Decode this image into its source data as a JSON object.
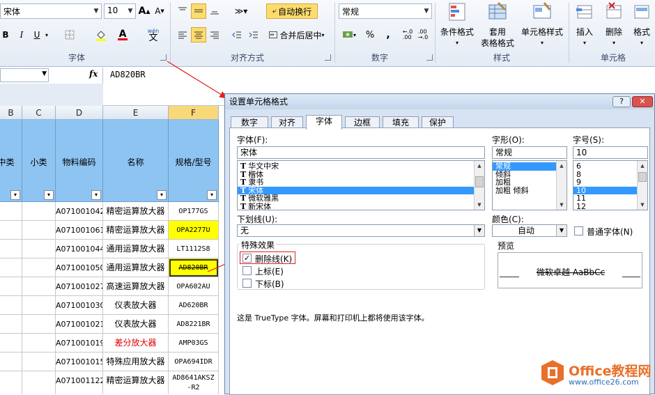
{
  "ribbon": {
    "font_name": "宋体",
    "font_size": "10",
    "bold": "B",
    "italic": "I",
    "underline": "U",
    "font_color_letter": "A",
    "wen": "wén",
    "wen_char": "文",
    "wrap_text": "自动换行",
    "merge_center": "合并后居中",
    "number_format": "常规",
    "percent": "%",
    "comma": ",",
    "cond_format": "条件格式",
    "table_format_line1": "套用",
    "table_format_line2": "表格格式",
    "cell_style": "单元格样式",
    "insert": "插入",
    "delete": "删除",
    "format": "格式",
    "groups": {
      "font": "字体",
      "align": "对齐方式",
      "number": "数字",
      "style": "样式",
      "cells": "单元格"
    }
  },
  "formula_bar": {
    "fx": "fx",
    "content": "AD820BR"
  },
  "sheet": {
    "col_letters": [
      "B",
      "C",
      "D",
      "E",
      "F"
    ],
    "headers": [
      "中类",
      "小类",
      "物料编码",
      "名称",
      "规格/型号"
    ],
    "rows": [
      {
        "code": "A071001042",
        "name": "精密运算放大器",
        "model": "OP177GS"
      },
      {
        "code": "A071001061",
        "name": "精密运算放大器",
        "model": "OPA2277U"
      },
      {
        "code": "A071001044",
        "name": "通用运算放大器",
        "model": "LT1112S8"
      },
      {
        "code": "A071001050",
        "name": "通用运算放大器",
        "model": "AD820BR"
      },
      {
        "code": "A071001027",
        "name": "高速运算放大器",
        "model": "OPA602AU"
      },
      {
        "code": "A071001030",
        "name": "仪表放大器",
        "model": "AD620BR"
      },
      {
        "code": "A071001021",
        "name": "仪表放大器",
        "model": "AD8221BR"
      },
      {
        "code": "A071001019",
        "name": "差分放大器",
        "model": "AMP03GS"
      },
      {
        "code": "A071001015",
        "name": "特殊应用放大器",
        "model": "OPA694IDR"
      },
      {
        "code": "A071001122",
        "name": "精密运算放大器",
        "model": "AD8641AKSZ",
        "model2": "-R2"
      }
    ]
  },
  "dialog": {
    "title": "设置单元格格式",
    "help": "?",
    "close": "✕",
    "tabs": [
      "数字",
      "对齐",
      "字体",
      "边框",
      "填充",
      "保护"
    ],
    "font_label": "字体(F):",
    "font_value": "宋体",
    "font_list": [
      "华文中宋",
      "楷体",
      "隶书",
      "宋体",
      "微软雅黑",
      "新宋体"
    ],
    "style_label": "字形(O):",
    "style_value": "常规",
    "style_list": [
      "常规",
      "倾斜",
      "加粗",
      "加粗 倾斜"
    ],
    "size_label": "字号(S):",
    "size_value": "10",
    "size_list": [
      "6",
      "8",
      "9",
      "10",
      "11",
      "12"
    ],
    "underline_label": "下划线(U):",
    "underline_value": "无",
    "color_label": "颜色(C):",
    "color_value": "自动",
    "normal_font": "普通字体(N)",
    "effects_label": "特殊效果",
    "strike": "删除线(K)",
    "superscript": "上标(E)",
    "subscript": "下标(B)",
    "preview_label": "预览",
    "preview_text": "微软卓越  AaBbCc",
    "note": "这是 TrueType 字体。屏幕和打印机上都将使用该字体。",
    "font_icon": "T"
  },
  "watermark": {
    "line1": "Office教程网",
    "line2": "www.office26.com"
  },
  "colors": {
    "header_blue": "#8ec4f2",
    "highlight_yellow": "#ffff00",
    "red_text": "#e00000",
    "arrow_red": "#e02020"
  }
}
